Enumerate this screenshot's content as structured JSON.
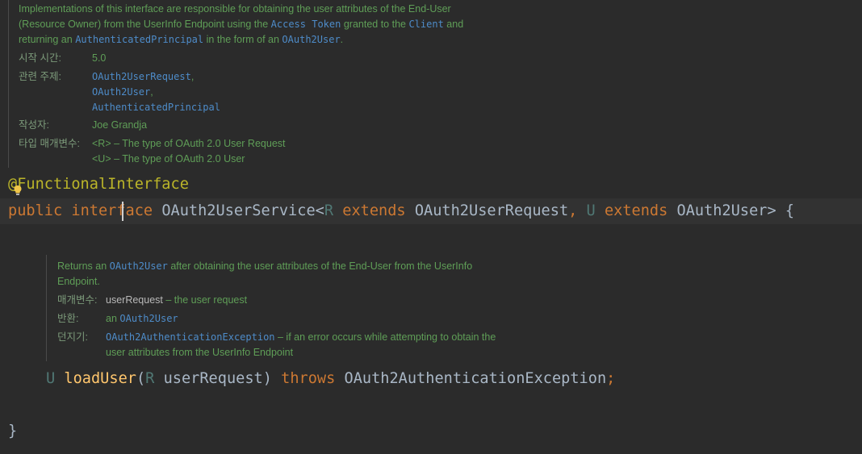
{
  "doc1": {
    "line1": "Implementations of this interface are responsible for obtaining the user attributes of the End-User",
    "line2_a": "(Resource Owner) from the UserInfo Endpoint using the ",
    "line2_code1": "Access Token",
    "line2_b": " granted to the ",
    "line2_code2": "Client",
    "line2_c": " and",
    "line3_a": "returning an ",
    "line3_code1": "AuthenticatedPrincipal",
    "line3_b": " in the form of an ",
    "line3_code2": "OAuth2User",
    "line3_c": ".",
    "since_label": "시작 시간:",
    "since_value": "5.0",
    "see_label": "관련 주제:",
    "see_items": [
      "OAuth2UserRequest",
      "OAuth2User",
      "AuthenticatedPrincipal"
    ],
    "see_sep1": ",",
    "see_sep2": ",",
    "author_label": "작성자:",
    "author_value": "Joe Grandja",
    "typeparams_label": "타입 매개변수:",
    "typeparam1": "<R> – The type of OAuth 2.0 User Request",
    "typeparam2": "<U> – The type of OAuth 2.0 User"
  },
  "code_line1": {
    "annotation": "@FunctionalInterface"
  },
  "code_line2": {
    "public": "public",
    "interface": "interface",
    "name": "OAuth2UserService",
    "lt": "<",
    "R": "R",
    "extends1": "extends",
    "req": "OAuth2UserRequest",
    "comma": ",",
    "U": "U",
    "extends2": "extends",
    "user": "OAuth2User",
    "gt_brace": "> {"
  },
  "doc2": {
    "line1_a": "Returns an ",
    "line1_code": "OAuth2User",
    "line1_b": " after obtaining the user attributes of the End-User from the UserInfo",
    "line2": "Endpoint.",
    "param_label": "매개변수:",
    "param_name": "userRequest",
    "param_desc": " – the user request",
    "return_label": "반환:",
    "return_a": "an ",
    "return_code": "OAuth2User",
    "throws_label": "던지기:",
    "throws_code": "OAuth2AuthenticationException",
    "throws_desc1": " – if an error occurs while attempting to obtain the",
    "throws_desc2": "user attributes from the UserInfo Endpoint"
  },
  "code_line3": {
    "U": "U",
    "method": "loadUser",
    "open": "(",
    "R": "R",
    "param": "userRequest)",
    "throws": "throws",
    "exception": "OAuth2AuthenticationException",
    "semi": ";"
  },
  "code_line4": {
    "close": "}"
  }
}
